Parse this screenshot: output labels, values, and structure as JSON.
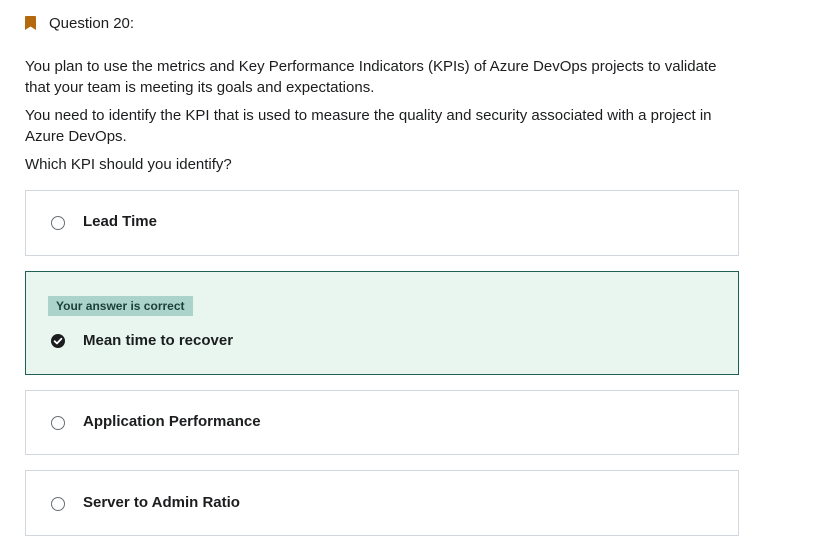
{
  "question": {
    "title": "Question 20:",
    "paragraphs": [
      "You plan to use the metrics and Key Performance Indicators (KPIs) of Azure DevOps projects to validate that your team is meeting its goals and expectations.",
      "You need to identify the KPI that is used to measure the quality and security associated with a project in Azure DevOps.",
      "Which KPI should you identify?"
    ]
  },
  "options": [
    {
      "label": "Lead Time",
      "selected": false
    },
    {
      "label": "Mean time to recover",
      "selected": true,
      "badge": "Your answer is correct"
    },
    {
      "label": "Application Performance",
      "selected": false
    },
    {
      "label": "Server to Admin Ratio",
      "selected": false
    }
  ],
  "colors": {
    "bookmark": "#b4690e",
    "correct_bg": "#e8f6ef",
    "correct_border": "#1e6055",
    "badge_bg": "#acd2cc",
    "text": "#1c1d1f"
  },
  "icons": {
    "bookmark": "bookmark-icon",
    "check": "check-circle-icon",
    "radio": "radio-icon"
  }
}
